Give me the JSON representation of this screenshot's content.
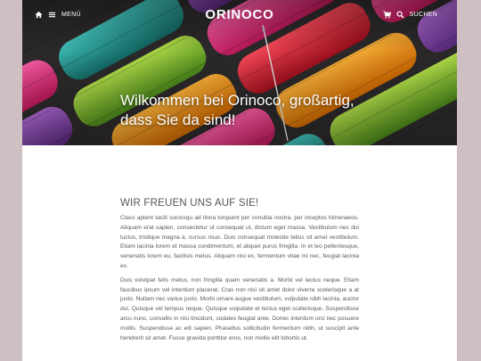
{
  "header": {
    "menu_label": "MENÜ",
    "logo": "ORINOCO",
    "search_label": "SUCHEN"
  },
  "hero": {
    "title": "Wilkommen bei Orinoco, großartig, dass Sie da sind!"
  },
  "main": {
    "heading": "WIR FREUEN UNS AUF SIE!",
    "paragraphs": [
      "Class aptent taciti sociosqu ad litora torquent per conubia nostra, per inceptos himenaeos. Aliquam erat sapien, consectetur ut consequat ut, dictum eget massa. Vestibulum nec dui luctus, tristique magna a, cursus risus. Duis consequat molestie tellus sit amet vestibulum. Etiam lacinia lorem et massa condimentum, et aliquet purus fringilla. In et leo pellentesque, venenatis lorem eu, facilisis metus. Aliquam nisi ex, fermentum vitae mi nec, feugiat lacinia ex.",
      "Duis volutpat felis metus, non fringilla quam venenatis a. Morbi vel lectus neque. Etiam faucibus ipsum vel interdum placerat. Cras non nisi sit amet dolor viverra scelerisque a at justo. Nullam nec varius justo. Morbi ornare augue vestibulum, vulputate nibh lacinia, auctor dui. Quisque vel tempus neque. Quisque vulputate et lectus eget scelerisque. Suspendisse arcu nunc, convallis in nisi tincidunt, sodales feugiat ante. Donec interdum orci nec posuere mollis. Suspendisse ac elit sapien. Phasellus sollicitudin fermentum nibh, ut suscipit ante hendrerit sit amet. Fusce gravida porttitor eros, non mollis elit lobortis ut."
    ]
  },
  "colors": {
    "backdrop": "#cdbfc2",
    "page": "#ffffff",
    "text": "#5a5a5a",
    "heading": "#555555",
    "hero_text": "#ffffff"
  },
  "icons": [
    "home-icon",
    "menu-icon",
    "cart-icon",
    "search-icon"
  ]
}
